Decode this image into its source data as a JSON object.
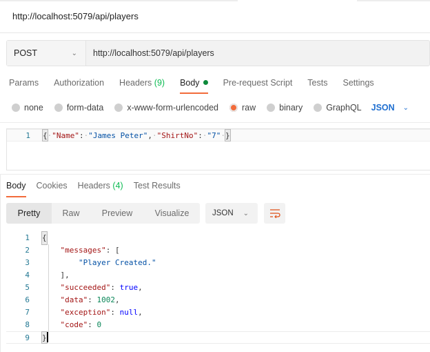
{
  "request": {
    "title": "http://localhost:5079/api/players",
    "method": "POST",
    "url": "http://localhost:5079/api/players"
  },
  "request_tabs": [
    {
      "label": "Params"
    },
    {
      "label": "Authorization"
    },
    {
      "label": "Headers",
      "count": "(9)"
    },
    {
      "label": "Body",
      "active": true,
      "indicator": "green-dot"
    },
    {
      "label": "Pre-request Script"
    },
    {
      "label": "Tests"
    },
    {
      "label": "Settings"
    }
  ],
  "body_types": [
    {
      "label": "none"
    },
    {
      "label": "form-data"
    },
    {
      "label": "x-www-form-urlencoded"
    },
    {
      "label": "raw",
      "selected": true
    },
    {
      "label": "binary"
    },
    {
      "label": "GraphQL"
    }
  ],
  "body_language": "JSON",
  "request_body": {
    "line_number": "1",
    "open": "{",
    "key1": "\"Name\"",
    "val1": "\"James Peter\"",
    "key2": "\"ShirtNo\"",
    "val2": "\"7\"",
    "close": "}"
  },
  "response_tabs": [
    {
      "label": "Body",
      "active": true
    },
    {
      "label": "Cookies"
    },
    {
      "label": "Headers",
      "count": "(4)"
    },
    {
      "label": "Test Results"
    }
  ],
  "view_modes": [
    "Pretty",
    "Raw",
    "Preview",
    "Visualize"
  ],
  "active_view_mode": "Pretty",
  "response_format": "JSON",
  "icons": {
    "method_dropdown": "chevron-down-icon",
    "language_dropdown": "chevron-down-icon",
    "format_dropdown": "chevron-down-icon",
    "wrap": "wrap-lines-icon"
  },
  "colors": {
    "accent": "#f26b3a",
    "count_green": "#0cbb52",
    "indicator_green": "#0e8a3b",
    "language_blue": "#1f6fd0"
  },
  "response_body": {
    "line_numbers": [
      "1",
      "2",
      "3",
      "4",
      "5",
      "6",
      "7",
      "8",
      "9"
    ],
    "open": "{",
    "messages_key": "\"messages\"",
    "messages_open": "[",
    "message_0": "\"Player Created.\"",
    "messages_close": "],",
    "succeeded_key": "\"succeeded\"",
    "succeeded_val": "true",
    "data_key": "\"data\"",
    "data_val": "1002",
    "exception_key": "\"exception\"",
    "exception_val": "null",
    "code_key": "\"code\"",
    "code_val": "0",
    "close": "}"
  }
}
